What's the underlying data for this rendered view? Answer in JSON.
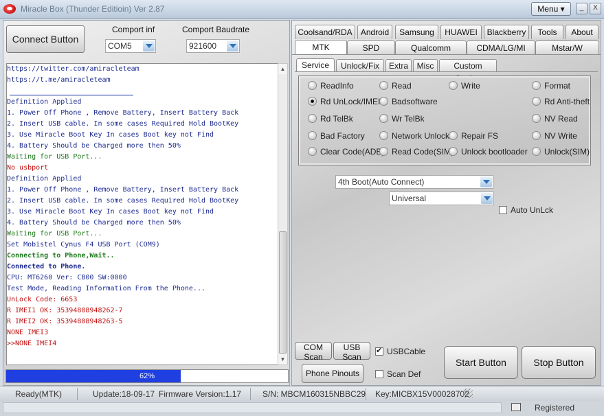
{
  "window": {
    "title": "Miracle Box (Thunder Editioin) Ver 2.87",
    "menu_label": "Menu",
    "minimize": "_",
    "close": "X"
  },
  "left": {
    "connect_label": "Connect Button",
    "comport_label": "Comport inf",
    "comport_value": "COM5",
    "baud_label": "Comport Baudrate",
    "baud_value": "921600"
  },
  "log": [
    {
      "text": "https://twitter.com/amiracleteam",
      "color": "#1d2b8f",
      "bold": false
    },
    {
      "text": "https://t.me/amiracleteam",
      "color": "#1d2b8f",
      "bold": false
    },
    {
      "text": "",
      "color": "#1d2b8f",
      "bold": false
    },
    {
      "text": "  Definition Applied",
      "color": "#1d2b8f",
      "bold": false
    },
    {
      "text": "  1. Power Off Phone , Remove Battery, Insert Battery Back",
      "color": "#1d2b8f",
      "bold": false
    },
    {
      "text": "  2. Insert USB cable. In some cases Required Hold BootKey",
      "color": "#1d2b8f",
      "bold": false
    },
    {
      "text": "  3. Use Miracle Boot Key In cases Boot key not Find",
      "color": "#1d2b8f",
      "bold": false
    },
    {
      "text": "  4. Battery Should be Charged more then 50%",
      "color": "#1d2b8f",
      "bold": false
    },
    {
      "text": "  Waiting for USB Port...",
      "color": "#1f7a1f",
      "bold": false
    },
    {
      "text": "  No usbport",
      "color": "#c01010",
      "bold": false
    },
    {
      "text": "  Definition Applied",
      "color": "#1d2b8f",
      "bold": false
    },
    {
      "text": "  1. Power Off Phone , Remove Battery, Insert Battery Back",
      "color": "#1d2b8f",
      "bold": false
    },
    {
      "text": "  2. Insert USB cable. In some cases Required Hold BootKey",
      "color": "#1d2b8f",
      "bold": false
    },
    {
      "text": "  3. Use Miracle Boot Key In cases Boot key not Find",
      "color": "#1d2b8f",
      "bold": false
    },
    {
      "text": "  4. Battery Should be Charged more then 50%",
      "color": "#1d2b8f",
      "bold": false
    },
    {
      "text": "  Waiting for USB Port...",
      "color": "#1f7a1f",
      "bold": false
    },
    {
      "text": "  Set Mobistel Cynus F4 USB Port (COM9)",
      "color": "#1d2b8f",
      "bold": false
    },
    {
      "text": "  Connecting to Phone,Wait..",
      "color": "#1f7a1f",
      "bold": true
    },
    {
      "text": "  Connected to Phone.",
      "color": "#1d2b8f",
      "bold": true
    },
    {
      "text": "  CPU: MT6260 Ver: CB00  SW:0000",
      "color": "#1d2b8f",
      "bold": false
    },
    {
      "text": "  Test Mode, Reading Information From the Phone...",
      "color": "#1d2b8f",
      "bold": false
    },
    {
      "text": "  UnLock Code: 6653",
      "color": "#c01010",
      "bold": false
    },
    {
      "text": "  R IMEI1 OK: 35394808948262-7",
      "color": "#c01010",
      "bold": false
    },
    {
      "text": "  R IMEI2 OK: 35394808948263-5",
      "color": "#c01010",
      "bold": false
    },
    {
      "text": "  NONE IMEI3",
      "color": "#c01010",
      "bold": false
    },
    {
      "text": ">>NONE IMEI4",
      "color": "#c01010",
      "bold": false
    }
  ],
  "progress": {
    "value": 0.62,
    "label": "62%",
    "color": "#1f3fe0"
  },
  "tabs_row1": [
    "Coolsand/RDA",
    "Android",
    "Samsung",
    "HUAWEI",
    "Blackberry",
    "Tools",
    "About"
  ],
  "tabs_row2": [
    "MTK",
    "SPD",
    "Qualcomm",
    "CDMA/LG/MI",
    "Mstar/W"
  ],
  "active_tab": "MTK",
  "subtabs": [
    "Service",
    "Unlock/Fix",
    "Extra",
    "Misc",
    "Custom Setting"
  ],
  "active_subtab": "Service",
  "radios": [
    "ReadInfo",
    "Read",
    "Write",
    "Format",
    "Rd UnLock/IMEI",
    "Badsoftware",
    "Rd Anti-theft",
    "Rd TelBk",
    "Wr TelBk",
    "NV Read",
    "Bad Factory",
    "Network Unlock",
    "Repair FS",
    "NV Write",
    "Clear Code(ADB)",
    "Read Code(SIM)",
    "Unlock bootloader",
    "Unlock(SIM)"
  ],
  "selected_radio": "Rd UnLock/IMEI",
  "boot_value": "4th Boot(Auto Connect)",
  "mode_value": "Universal",
  "auto_unlock_label": "Auto UnLck",
  "controls": {
    "com_scan": "COM Scan",
    "usb_scan": "USB Scan",
    "usb_cable": "USBCable",
    "usb_cable_checked": true,
    "phone_pinouts": "Phone Pinouts",
    "scan_def": "Scan Def",
    "scan_def_checked": false,
    "start": "Start Button",
    "stop": "Stop Button"
  },
  "status": {
    "ready": "Ready(MTK)",
    "update": "Update:18-09-17",
    "firmware": "Firmware Version:1.17",
    "sn": "S/N: MBCM160315NBBC29",
    "key": "Key:MICBX15V00028702",
    "registered": "Registered"
  }
}
